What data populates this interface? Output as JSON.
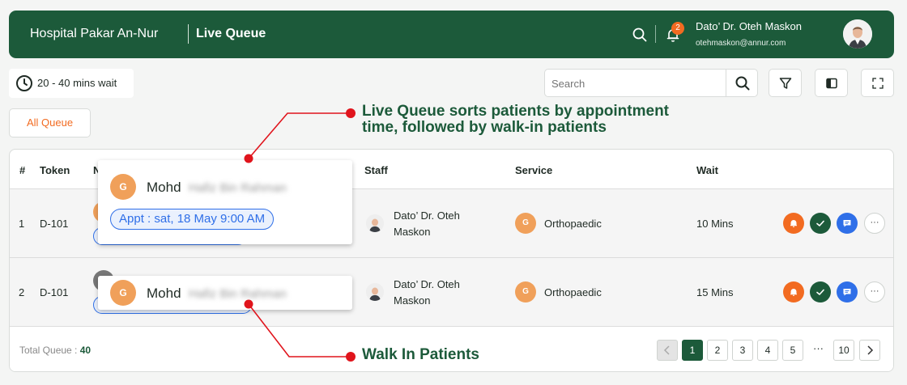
{
  "header": {
    "hospital": "Hospital Pakar An-Nur",
    "page_title": "Live Queue",
    "notification_count": "2",
    "user_name": "Dato’ Dr. Oteh Maskon",
    "user_email": "otehmaskon@annur.com"
  },
  "toolbar": {
    "wait_text": "20 - 40 mins wait",
    "search_placeholder": "Search",
    "all_queue": "All Queue"
  },
  "table": {
    "columns": [
      "#",
      "Token",
      "N",
      "Staff",
      "Service",
      "Wait"
    ],
    "rows": [
      {
        "num": "1",
        "token": "D-101",
        "staff_line1": "Dato’ Dr. Oteh",
        "staff_line2": "Maskon",
        "service_initial": "G",
        "service": "Orthopaedic",
        "wait": "10 Mins"
      },
      {
        "num": "2",
        "token": "D-101",
        "staff_line1": "Dato’ Dr. Oteh",
        "staff_line2": "Maskon",
        "service_initial": "G",
        "service": "Orthopaedic",
        "wait": "15 Mins"
      }
    ],
    "total_label": "Total Queue :",
    "total_value": "40"
  },
  "pagination": {
    "pages": [
      "1",
      "2",
      "3",
      "4",
      "5",
      "10"
    ],
    "ellipsis": "···",
    "current": 1
  },
  "popups": {
    "appointment": {
      "initial": "G",
      "first_name": "Mohd",
      "hidden_name": "Hafiz Bin Rahman",
      "pill": "Appt : sat, 18 May 9:00 AM"
    },
    "walkin": {
      "initial": "G",
      "first_name": "Mohd",
      "hidden_name": "Hafiz Bin Rahman"
    }
  },
  "annotations": {
    "top_line1": "Live Queue sorts patients by appointment",
    "top_line2": "time, followed by walk-in patients",
    "bottom": "Walk In Patients"
  },
  "colors": {
    "brand_green": "#1c5a3a",
    "accent_orange": "#f26b21",
    "annotation_red": "#e0141c",
    "pill_blue": "#2f6fe8"
  }
}
